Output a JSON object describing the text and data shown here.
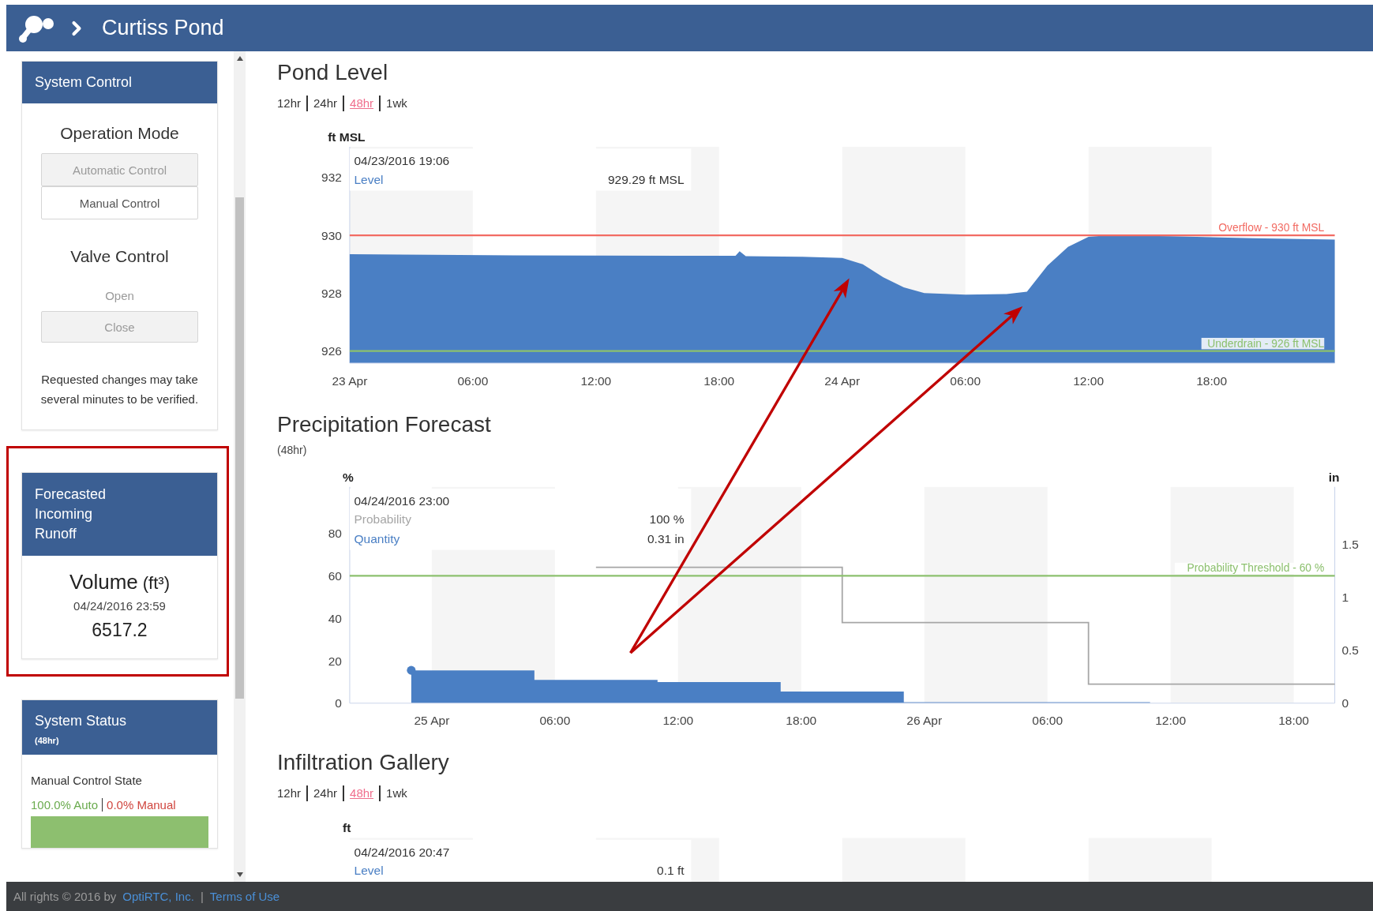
{
  "header": {
    "title": "Curtiss Pond"
  },
  "sidebar": {
    "system_control": {
      "title": "System Control",
      "operation_mode": {
        "label": "Operation Mode",
        "options": [
          {
            "label": "Automatic Control",
            "selected": true,
            "disabled": true
          },
          {
            "label": "Manual Control",
            "selected": false,
            "disabled": false
          }
        ]
      },
      "valve_control": {
        "label": "Valve Control",
        "options": [
          {
            "label": "Open",
            "selected": false,
            "disabled": true
          },
          {
            "label": "Close",
            "selected": true,
            "disabled": true
          }
        ]
      },
      "note": "Requested changes may take several minutes to be verified."
    },
    "runoff": {
      "title": "Forecasted Incoming Runoff",
      "label": "Volume",
      "unit": "(ft³)",
      "time": "04/24/2016 23:59",
      "value": "6517.2"
    },
    "system_status": {
      "title": "System Status",
      "subtitle": "(48hr)",
      "label": "Manual Control State",
      "auto": "100.0% Auto",
      "manual": "0.0% Manual",
      "level": 1
    }
  },
  "pond_level": {
    "title": "Pond Level",
    "ranges": [
      {
        "label": "12hr",
        "selected": false
      },
      {
        "label": "24hr",
        "selected": false
      },
      {
        "label": "48hr",
        "selected": true
      },
      {
        "label": "1wk",
        "selected": false
      }
    ],
    "tooltip": {
      "time": "04/23/2016 19:06",
      "values": [
        "929.29 ft MSL"
      ]
    },
    "chart_data": {
      "type": "area",
      "ylabel": "ft MSL",
      "xlim": [
        "2016-04-23T00:00",
        "2016-04-25T00:00"
      ],
      "ylim": [
        925.58,
        933.06
      ],
      "xticks": [
        {
          "value": "2016-04-23T00:00",
          "label": "23 Apr"
        },
        {
          "value": "2016-04-23T06:00",
          "label": "06:00"
        },
        {
          "value": "2016-04-23T12:00",
          "label": "12:00"
        },
        {
          "value": "2016-04-23T18:00",
          "label": "18:00"
        },
        {
          "value": "2016-04-24T00:00",
          "label": "24 Apr"
        },
        {
          "value": "2016-04-24T06:00",
          "label": "06:00"
        },
        {
          "value": "2016-04-24T12:00",
          "label": "12:00"
        },
        {
          "value": "2016-04-24T18:00",
          "label": "18:00"
        }
      ],
      "yticks": [
        926,
        928,
        930,
        932
      ],
      "x": [
        "2016-04-23T00:00",
        "2016-04-23T04:00",
        "2016-04-23T08:00",
        "2016-04-23T12:00",
        "2016-04-23T16:00",
        "2016-04-23T18:48",
        "2016-04-23T19:00",
        "2016-04-23T19:18",
        "2016-04-23T22:00",
        "2016-04-24T00:00",
        "2016-04-24T01:00",
        "2016-04-24T02:00",
        "2016-04-24T03:00",
        "2016-04-24T04:00",
        "2016-04-24T06:00",
        "2016-04-24T08:00",
        "2016-04-24T09:00",
        "2016-04-24T09:30",
        "2016-04-24T10:00",
        "2016-04-24T11:00",
        "2016-04-24T12:00",
        "2016-04-24T13:00",
        "2016-04-24T16:00",
        "2016-04-24T20:00",
        "2016-04-25T00:00"
      ],
      "series": [
        {
          "name": "Level",
          "color": "#4a7fc4",
          "values": [
            929.35,
            929.33,
            929.31,
            929.3,
            929.29,
            929.29,
            929.45,
            929.28,
            929.26,
            929.22,
            929.0,
            928.55,
            928.2,
            928.0,
            927.95,
            927.97,
            928.05,
            928.5,
            928.95,
            929.6,
            929.95,
            930.0,
            929.97,
            929.9,
            929.85
          ]
        }
      ],
      "ref_lines": [
        {
          "axis": "y",
          "value": 930,
          "label": "Overflow - 930 ft MSL",
          "color": "#f26b63"
        },
        {
          "axis": "y",
          "value": 926,
          "label": "Underdrain - 926 ft MSL",
          "color": "#8cc06e"
        }
      ]
    }
  },
  "precipitation": {
    "title": "Precipitation Forecast",
    "subtitle": "(48hr)",
    "tooltip": {
      "time": "04/24/2016 23:00",
      "values": [
        "100 %",
        "0.31 in"
      ]
    },
    "chart_data": {
      "type": "area",
      "ylabel": "%",
      "y2label": "in",
      "xlim": [
        "2016-04-24T20:00",
        "2016-04-26T20:00"
      ],
      "ylim": [
        0,
        101.9
      ],
      "y2lim": [
        0,
        2.04
      ],
      "xticks": [
        {
          "value": "2016-04-25T00:00",
          "label": "25 Apr"
        },
        {
          "value": "2016-04-25T06:00",
          "label": "06:00"
        },
        {
          "value": "2016-04-25T12:00",
          "label": "12:00"
        },
        {
          "value": "2016-04-25T18:00",
          "label": "18:00"
        },
        {
          "value": "2016-04-26T00:00",
          "label": "26 Apr"
        },
        {
          "value": "2016-04-26T06:00",
          "label": "06:00"
        },
        {
          "value": "2016-04-26T12:00",
          "label": "12:00"
        },
        {
          "value": "2016-04-26T18:00",
          "label": "18:00"
        }
      ],
      "yticks": [
        0,
        20,
        40,
        60,
        80
      ],
      "y2ticks": [
        0,
        0.5,
        1,
        1.5
      ],
      "x": [
        "2016-04-24T23:00",
        "2016-04-25T05:00",
        "2016-04-25T05:00",
        "2016-04-25T08:00",
        "2016-04-25T08:00",
        "2016-04-25T11:00",
        "2016-04-25T11:00",
        "2016-04-25T17:00",
        "2016-04-25T17:00",
        "2016-04-25T20:00",
        "2016-04-25T20:00",
        "2016-04-25T23:00",
        "2016-04-25T23:00",
        "2016-04-26T08:00",
        "2016-04-26T08:00",
        "2016-04-26T11:00",
        "2016-04-26T11:00",
        "2016-04-26T20:00"
      ],
      "series": [
        {
          "name": "Probability",
          "type": "line",
          "color": "#a6a6a6",
          "values": [
            null,
            null,
            null,
            null,
            64,
            64,
            64,
            64,
            64,
            64,
            38,
            38,
            38,
            38,
            9,
            9,
            9,
            9
          ]
        },
        {
          "name": "Quantity",
          "axis": "y2",
          "color": "#4a7fc4",
          "values": [
            0.31,
            0.31,
            0.22,
            0.22,
            0.22,
            0.22,
            0.2,
            0.2,
            0.11,
            0.11,
            0.11,
            0.11,
            0.01,
            0.01,
            0.01,
            0.01,
            null,
            null
          ]
        }
      ],
      "ref_lines": [
        {
          "axis": "y",
          "value": 60,
          "label": "Probability Threshold - 60 %",
          "color": "#8cc06e"
        }
      ]
    }
  },
  "infiltration": {
    "title": "Infiltration Gallery",
    "ranges": [
      {
        "label": "12hr",
        "selected": false
      },
      {
        "label": "24hr",
        "selected": false
      },
      {
        "label": "48hr",
        "selected": true
      },
      {
        "label": "1wk",
        "selected": false
      }
    ],
    "ylabel": "ft",
    "tooltip": {
      "time": "04/24/2016 20:47",
      "label": "Level",
      "value": "0.1 ft"
    }
  },
  "footer": {
    "text": "All rights © 2016 by",
    "links": [
      "OptiRTC, Inc.",
      "Terms of Use"
    ],
    "separator": "|"
  }
}
